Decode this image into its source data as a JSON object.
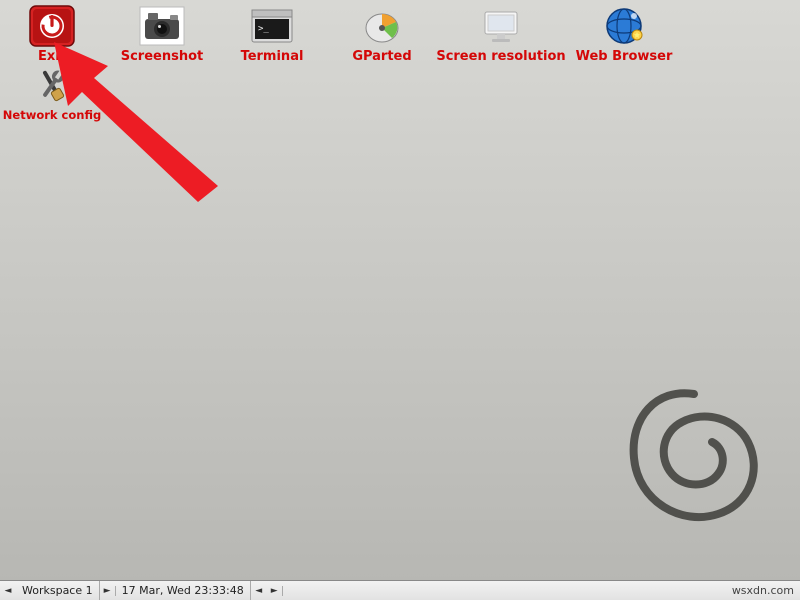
{
  "desktop_icons_row1": [
    {
      "id": "exit",
      "label": "Exit"
    },
    {
      "id": "screenshot",
      "label": "Screenshot"
    },
    {
      "id": "terminal",
      "label": "Terminal"
    },
    {
      "id": "gparted",
      "label": "GParted"
    },
    {
      "id": "screenres",
      "label": "Screen resolution"
    },
    {
      "id": "browser",
      "label": "Web Browser"
    }
  ],
  "desktop_icons_row2": [
    {
      "id": "netconfig",
      "label": "Network config"
    }
  ],
  "annotation": {
    "points_to": "exit-icon",
    "color": "#ed1c24"
  },
  "logo": "debian-swirl",
  "taskbar": {
    "prev_workspace": "◄",
    "workspace_label": "Workspace 1",
    "next_workspace": "►",
    "clock": "17 Mar, Wed 23:33:48",
    "pager_prev": "◄",
    "pager_next": "►"
  },
  "watermark": "wsxdn.com",
  "colors": {
    "label": "#d40707",
    "arrow": "#ed1c24"
  }
}
